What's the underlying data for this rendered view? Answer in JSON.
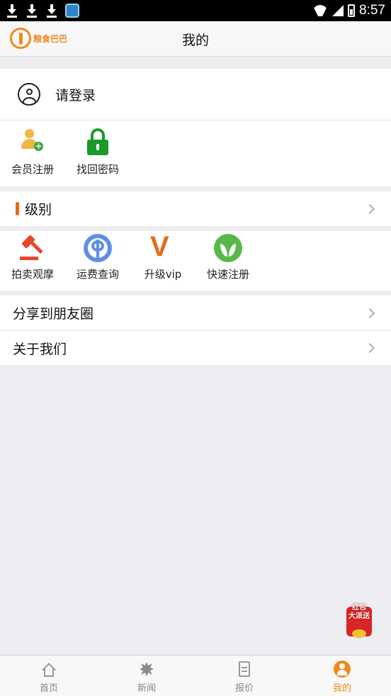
{
  "status_bar": {
    "time": "8:57",
    "icons": [
      "download-icon",
      "download-icon",
      "download-icon",
      "app-notification-icon",
      "wifi-icon",
      "signal-icon",
      "battery-icon"
    ]
  },
  "header": {
    "logo_text": "粮食巴巴",
    "title": "我的"
  },
  "login": {
    "prompt": "请登录",
    "quick_actions": [
      {
        "label": "会员注册",
        "icon": "add-member-icon"
      },
      {
        "label": "找回密码",
        "icon": "unlock-icon"
      }
    ]
  },
  "level": {
    "label": "级别"
  },
  "services": [
    {
      "label": "拍卖观摩",
      "icon": "gavel-icon"
    },
    {
      "label": "运费查询",
      "icon": "metro-icon"
    },
    {
      "label": "升级vip",
      "icon": "vip-icon"
    },
    {
      "label": "快速注册",
      "icon": "leaf-icon"
    }
  ],
  "menu": [
    {
      "label": "分享到朋友圈"
    },
    {
      "label": "关于我们"
    }
  ],
  "red_packet": {
    "text_line1": "红包",
    "text_line2": "大派送"
  },
  "tabbar": {
    "active_index": 3,
    "tabs": [
      {
        "label": "首页",
        "icon": "home-icon"
      },
      {
        "label": "新闻",
        "icon": "news-icon"
      },
      {
        "label": "报价",
        "icon": "document-icon"
      },
      {
        "label": "我的",
        "icon": "user-icon"
      }
    ]
  },
  "colors": {
    "accent": "#f08a1c",
    "level_marker": "#e86a17",
    "background": "#eeeef2"
  }
}
